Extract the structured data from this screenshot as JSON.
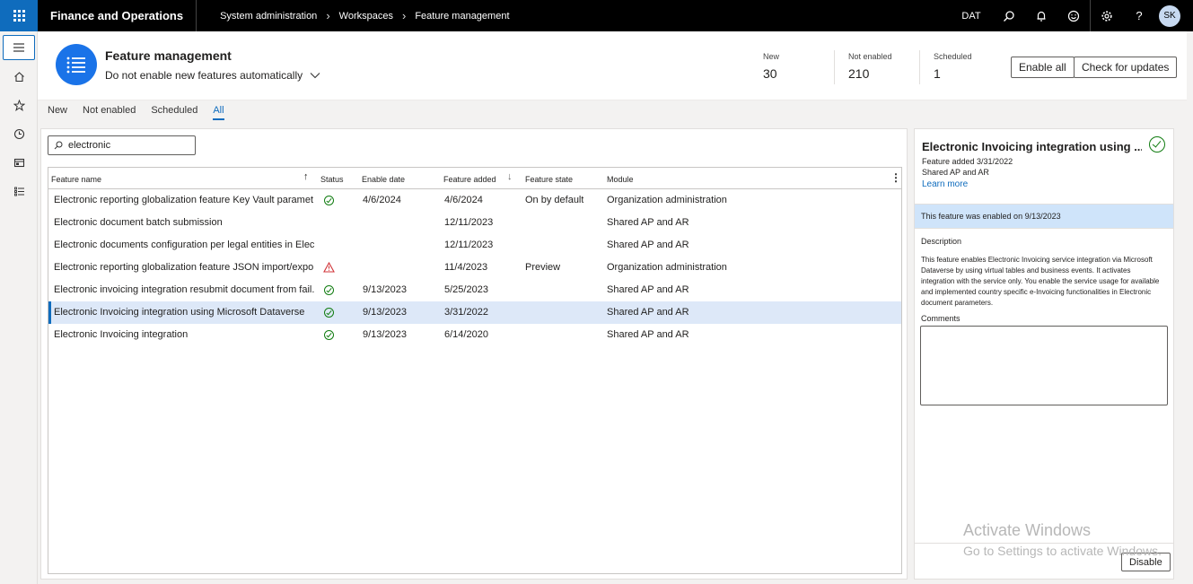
{
  "app": {
    "title": "Finance and Operations"
  },
  "breadcrumb": [
    "System administration",
    "Workspaces",
    "Feature management"
  ],
  "topbar": {
    "company": "DAT",
    "avatar": "SK"
  },
  "workspace": {
    "title": "Feature management",
    "setting": "Do not enable new features automatically",
    "stats": [
      {
        "label": "New",
        "value": "30"
      },
      {
        "label": "Not enabled",
        "value": "210"
      },
      {
        "label": "Scheduled",
        "value": "1"
      }
    ],
    "enable_all": "Enable all",
    "check_updates": "Check for updates"
  },
  "tabs": [
    "New",
    "Not enabled",
    "Scheduled",
    "All"
  ],
  "search": {
    "value": "electronic"
  },
  "grid": {
    "columns": [
      "Feature name",
      "Status",
      "Enable date",
      "Feature added",
      "Feature state",
      "Module"
    ],
    "rows": [
      {
        "name": "Electronic reporting globalization feature Key Vault paramet...",
        "status": "enabled",
        "enable_date": "4/6/2024",
        "added": "4/6/2024",
        "state": "On by default",
        "module": "Organization administration"
      },
      {
        "name": "Electronic document batch submission",
        "status": "",
        "enable_date": "",
        "added": "12/11/2023",
        "state": "",
        "module": "Shared AP and AR"
      },
      {
        "name": "Electronic documents configuration per legal entities in Elect...",
        "status": "",
        "enable_date": "",
        "added": "12/11/2023",
        "state": "",
        "module": "Shared AP and AR"
      },
      {
        "name": "Electronic reporting globalization feature JSON import/export",
        "status": "warning",
        "enable_date": "",
        "added": "11/4/2023",
        "state": "Preview",
        "module": "Organization administration"
      },
      {
        "name": "Electronic invoicing integration resubmit document from fail...",
        "status": "enabled",
        "enable_date": "9/13/2023",
        "added": "5/25/2023",
        "state": "",
        "module": "Shared AP and AR"
      },
      {
        "name": "Electronic Invoicing integration using Microsoft Dataverse",
        "status": "enabled",
        "enable_date": "9/13/2023",
        "added": "3/31/2022",
        "state": "",
        "module": "Shared AP and AR"
      },
      {
        "name": "Electronic Invoicing integration",
        "status": "enabled",
        "enable_date": "9/13/2023",
        "added": "6/14/2020",
        "state": "",
        "module": "Shared AP and AR"
      }
    ]
  },
  "detail": {
    "title": "Electronic Invoicing integration using ...",
    "added": "Feature added 3/31/2022",
    "module": "Shared AP and AR",
    "learn_more": "Learn more",
    "banner": "This feature was enabled on 9/13/2023",
    "description_label": "Description",
    "description": "This feature enables Electronic Invoicing service integration via Microsoft Dataverse by using virtual tables and business events. It activates integration with the service only. You enable the service usage for available and implemented country specific e-Invoicing functionalities in Electronic document parameters.",
    "comments_label": "Comments",
    "disable": "Disable"
  },
  "watermark": {
    "line1": "Activate Windows",
    "line2": "Go to Settings to activate Windows."
  },
  "colors": {
    "accent": "#0f6cbd",
    "success": "#107c10",
    "warning": "#d13438",
    "selected_row": "#dde8f8",
    "banner": "#cfe4fa"
  }
}
